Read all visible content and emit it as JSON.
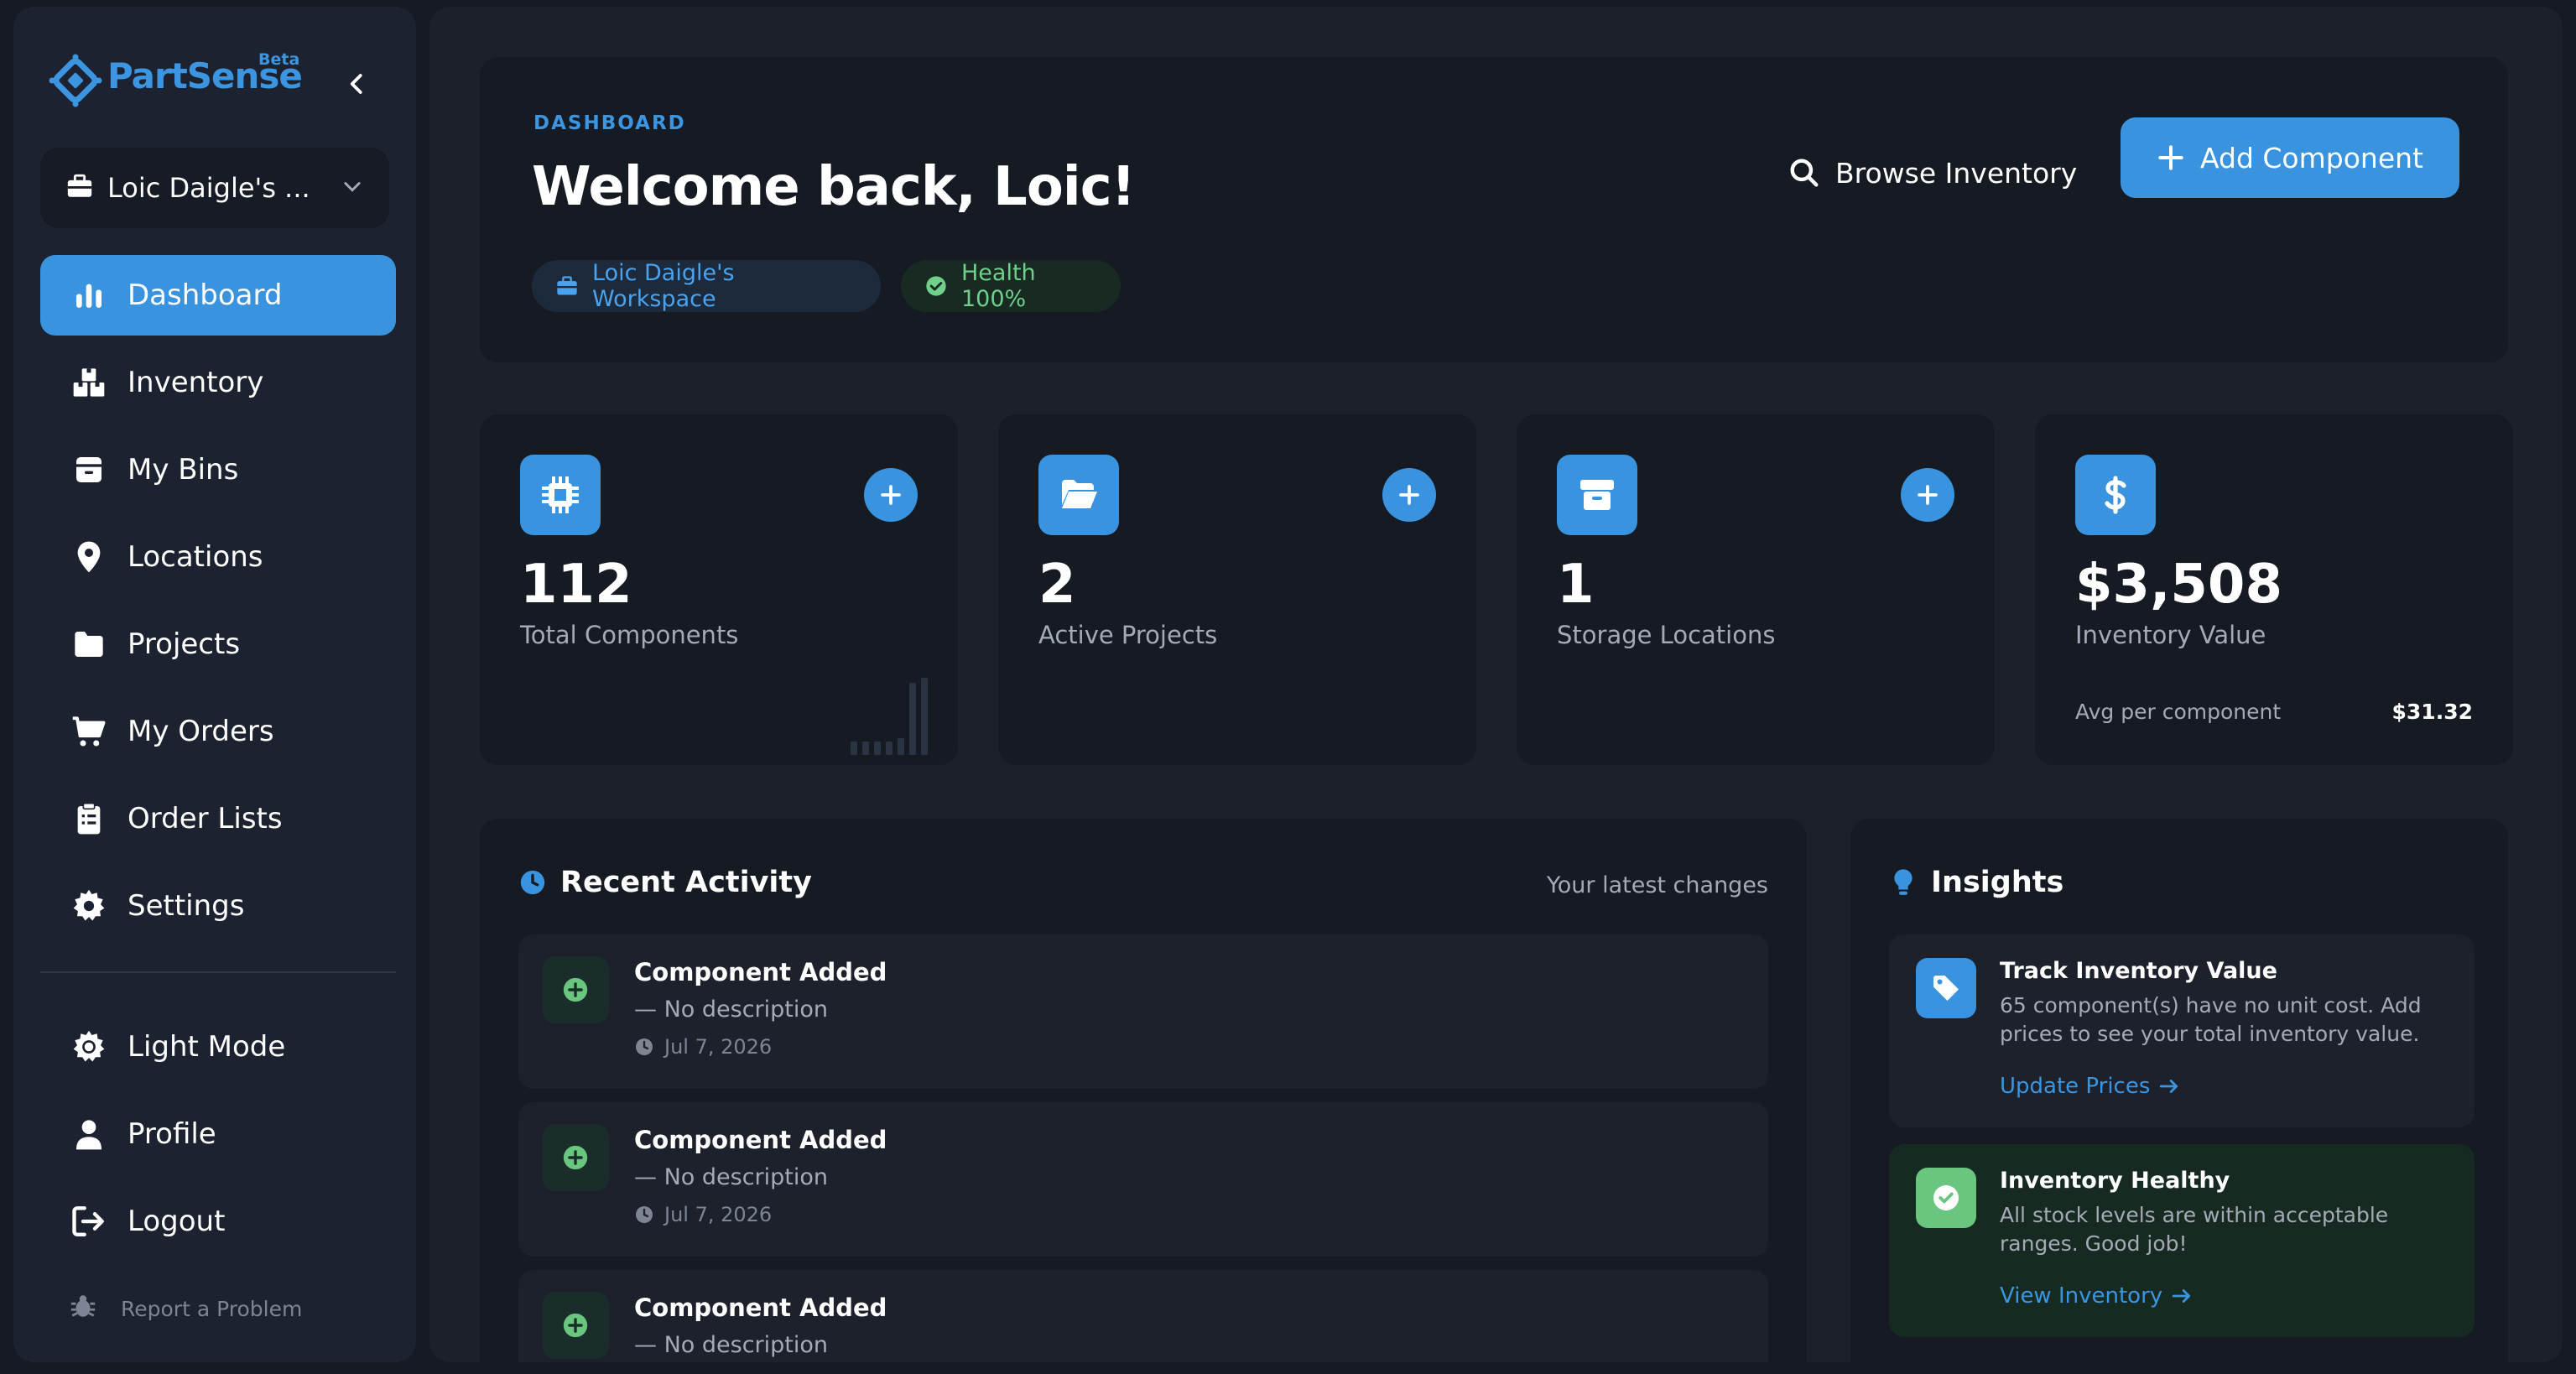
{
  "brand": {
    "name": "PartSense",
    "badge": "Beta"
  },
  "workspace_select": {
    "label": "Loic Daigle's ..."
  },
  "nav": {
    "items": [
      {
        "label": "Dashboard"
      },
      {
        "label": "Inventory"
      },
      {
        "label": "My Bins"
      },
      {
        "label": "Locations"
      },
      {
        "label": "Projects"
      },
      {
        "label": "My Orders"
      },
      {
        "label": "Order Lists"
      },
      {
        "label": "Settings"
      }
    ],
    "bottom": [
      {
        "label": "Light Mode"
      },
      {
        "label": "Profile"
      },
      {
        "label": "Logout"
      }
    ],
    "report": "Report a Problem"
  },
  "hero": {
    "eyebrow": "DASHBOARD",
    "title": "Welcome back, Loic!",
    "workspace_pill": "Loic Daigle's Workspace",
    "health_pill": "Health 100%",
    "browse_label": "Browse Inventory",
    "add_label": "Add Component"
  },
  "stats": [
    {
      "value": "112",
      "label": "Total Components"
    },
    {
      "value": "2",
      "label": "Active Projects"
    },
    {
      "value": "1",
      "label": "Storage Locations"
    },
    {
      "value": "$3,508",
      "label": "Inventory Value",
      "footer_label": "Avg per component",
      "footer_value": "$31.32"
    }
  ],
  "activity": {
    "title": "Recent Activity",
    "subtitle": "Your latest changes",
    "items": [
      {
        "title": "Component Added",
        "desc": "— No description",
        "date": "Jul 7, 2026"
      },
      {
        "title": "Component Added",
        "desc": "— No description",
        "date": "Jul 7, 2026"
      },
      {
        "title": "Component Added",
        "desc": "— No description",
        "date": ""
      }
    ]
  },
  "insights": {
    "title": "Insights",
    "cards": [
      {
        "title": "Track Inventory Value",
        "text": "65 component(s) have no unit cost. Add prices to see your total inventory value.",
        "link": "Update Prices"
      },
      {
        "title": "Inventory Healthy",
        "text": "All stock levels are within acceptable ranges. Good job!",
        "link": "View Inventory"
      }
    ]
  },
  "colors": {
    "accent": "#3a93de",
    "success": "#6ac57f",
    "background": "#141922",
    "panel": "#151a23"
  }
}
